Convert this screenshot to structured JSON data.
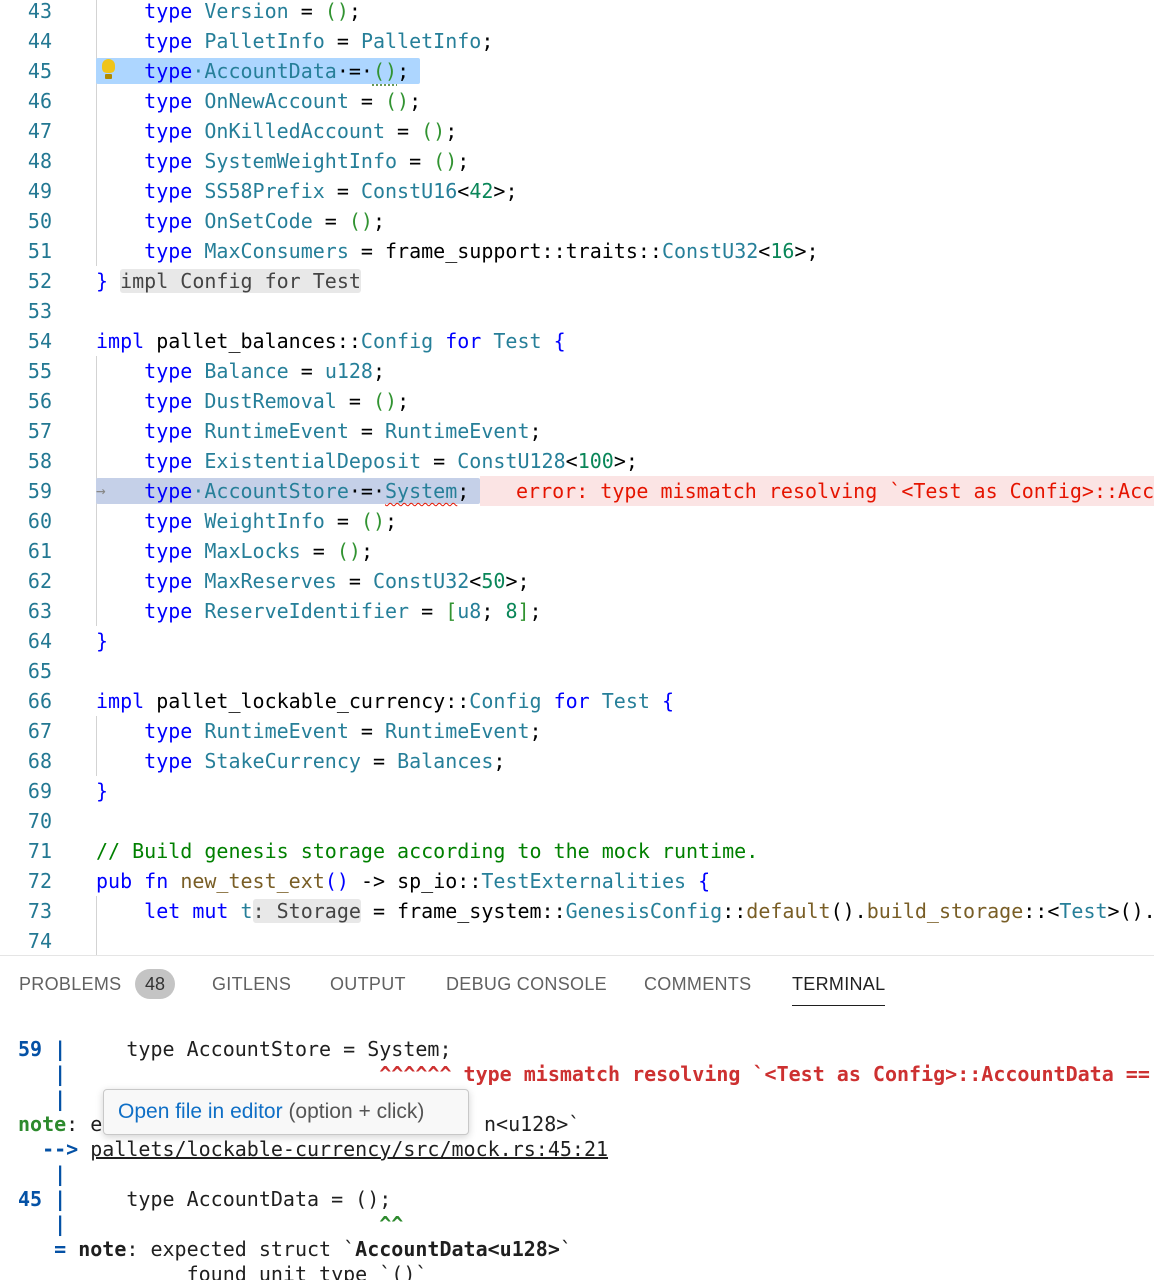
{
  "editor": {
    "lines": [
      {
        "n": "43",
        "segs": [
          [
            "    ",
            ""
          ],
          [
            "type",
            "kw"
          ],
          [
            " ",
            ""
          ],
          [
            "Version",
            "ty"
          ],
          [
            " = ",
            ""
          ],
          [
            "()",
            "pu"
          ],
          [
            ";",
            ""
          ]
        ]
      },
      {
        "n": "44",
        "segs": [
          [
            "    ",
            ""
          ],
          [
            "type",
            "kw"
          ],
          [
            " ",
            ""
          ],
          [
            "PalletInfo",
            "ty"
          ],
          [
            " = ",
            ""
          ],
          [
            "PalletInfo",
            "ty"
          ],
          [
            ";",
            ""
          ]
        ]
      },
      {
        "n": "45",
        "segs": [
          [
            "    ",
            ""
          ],
          [
            "type",
            "kw"
          ],
          [
            "·",
            "ty"
          ],
          [
            "AccountData",
            "ty"
          ],
          [
            "·=·",
            ""
          ],
          [
            "()",
            "pu dots"
          ],
          [
            ";",
            ""
          ]
        ]
      },
      {
        "n": "46",
        "segs": [
          [
            "    ",
            ""
          ],
          [
            "type",
            "kw"
          ],
          [
            " ",
            ""
          ],
          [
            "OnNewAccount",
            "ty"
          ],
          [
            " = ",
            ""
          ],
          [
            "()",
            "pu"
          ],
          [
            ";",
            ""
          ]
        ]
      },
      {
        "n": "47",
        "segs": [
          [
            "    ",
            ""
          ],
          [
            "type",
            "kw"
          ],
          [
            " ",
            ""
          ],
          [
            "OnKilledAccount",
            "ty"
          ],
          [
            " = ",
            ""
          ],
          [
            "()",
            "pu"
          ],
          [
            ";",
            ""
          ]
        ]
      },
      {
        "n": "48",
        "segs": [
          [
            "    ",
            ""
          ],
          [
            "type",
            "kw"
          ],
          [
            " ",
            ""
          ],
          [
            "SystemWeightInfo",
            "ty"
          ],
          [
            " = ",
            ""
          ],
          [
            "()",
            "pu"
          ],
          [
            ";",
            ""
          ]
        ]
      },
      {
        "n": "49",
        "segs": [
          [
            "    ",
            ""
          ],
          [
            "type",
            "kw"
          ],
          [
            " ",
            ""
          ],
          [
            "SS58Prefix",
            "ty"
          ],
          [
            " = ",
            ""
          ],
          [
            "ConstU16",
            "ty"
          ],
          [
            "<",
            ""
          ],
          [
            "42",
            "nu"
          ],
          [
            ">;",
            ""
          ]
        ]
      },
      {
        "n": "50",
        "segs": [
          [
            "    ",
            ""
          ],
          [
            "type",
            "kw"
          ],
          [
            " ",
            ""
          ],
          [
            "OnSetCode",
            "ty"
          ],
          [
            " = ",
            ""
          ],
          [
            "()",
            "pu"
          ],
          [
            ";",
            ""
          ]
        ]
      },
      {
        "n": "51",
        "segs": [
          [
            "    ",
            ""
          ],
          [
            "type",
            "kw"
          ],
          [
            " ",
            ""
          ],
          [
            "MaxConsumers",
            "ty"
          ],
          [
            " = frame_support::traits::",
            ""
          ],
          [
            "ConstU32",
            "ty"
          ],
          [
            "<",
            ""
          ],
          [
            "16",
            "nu"
          ],
          [
            ">;",
            ""
          ]
        ]
      },
      {
        "n": "52",
        "segs": [
          [
            "}",
            "kw"
          ],
          [
            " ",
            ""
          ],
          [
            "impl Config for Test",
            "hint"
          ]
        ]
      },
      {
        "n": "53",
        "segs": []
      },
      {
        "n": "54",
        "segs": [
          [
            "impl",
            "kw"
          ],
          [
            " pallet_balances::",
            ""
          ],
          [
            "Config",
            "ty"
          ],
          [
            " ",
            ""
          ],
          [
            "for",
            "kw"
          ],
          [
            " ",
            ""
          ],
          [
            "Test",
            "ty"
          ],
          [
            " ",
            ""
          ],
          [
            "{",
            "kw"
          ]
        ]
      },
      {
        "n": "55",
        "segs": [
          [
            "    ",
            ""
          ],
          [
            "type",
            "kw"
          ],
          [
            " ",
            ""
          ],
          [
            "Balance",
            "ty"
          ],
          [
            " = ",
            ""
          ],
          [
            "u128",
            "ty"
          ],
          [
            ";",
            ""
          ]
        ]
      },
      {
        "n": "56",
        "segs": [
          [
            "    ",
            ""
          ],
          [
            "type",
            "kw"
          ],
          [
            " ",
            ""
          ],
          [
            "DustRemoval",
            "ty"
          ],
          [
            " = ",
            ""
          ],
          [
            "()",
            "pu"
          ],
          [
            ";",
            ""
          ]
        ]
      },
      {
        "n": "57",
        "segs": [
          [
            "    ",
            ""
          ],
          [
            "type",
            "kw"
          ],
          [
            " ",
            ""
          ],
          [
            "RuntimeEvent",
            "ty"
          ],
          [
            " = ",
            ""
          ],
          [
            "RuntimeEvent",
            "ty"
          ],
          [
            ";",
            ""
          ]
        ]
      },
      {
        "n": "58",
        "segs": [
          [
            "    ",
            ""
          ],
          [
            "type",
            "kw"
          ],
          [
            " ",
            ""
          ],
          [
            "ExistentialDeposit",
            "ty"
          ],
          [
            " = ",
            ""
          ],
          [
            "ConstU128",
            "ty"
          ],
          [
            "<",
            ""
          ],
          [
            "100",
            "nu"
          ],
          [
            ">;",
            ""
          ]
        ]
      },
      {
        "n": "59",
        "segs": [
          [
            "    ",
            ""
          ],
          [
            "type",
            "kw"
          ],
          [
            "·",
            "ty"
          ],
          [
            "AccountStore",
            "ty"
          ],
          [
            "·=·",
            ""
          ],
          [
            "System",
            "ty squiggle"
          ],
          [
            ";",
            ""
          ]
        ]
      },
      {
        "n": "60",
        "segs": [
          [
            "    ",
            ""
          ],
          [
            "type",
            "kw"
          ],
          [
            " ",
            ""
          ],
          [
            "WeightInfo",
            "ty"
          ],
          [
            " = ",
            ""
          ],
          [
            "()",
            "pu"
          ],
          [
            ";",
            ""
          ]
        ]
      },
      {
        "n": "61",
        "segs": [
          [
            "    ",
            ""
          ],
          [
            "type",
            "kw"
          ],
          [
            " ",
            ""
          ],
          [
            "MaxLocks",
            "ty"
          ],
          [
            " = ",
            ""
          ],
          [
            "()",
            "pu"
          ],
          [
            ";",
            ""
          ]
        ]
      },
      {
        "n": "62",
        "segs": [
          [
            "    ",
            ""
          ],
          [
            "type",
            "kw"
          ],
          [
            " ",
            ""
          ],
          [
            "MaxReserves",
            "ty"
          ],
          [
            " = ",
            ""
          ],
          [
            "ConstU32",
            "ty"
          ],
          [
            "<",
            ""
          ],
          [
            "50",
            "nu"
          ],
          [
            ">;",
            ""
          ]
        ]
      },
      {
        "n": "63",
        "segs": [
          [
            "    ",
            ""
          ],
          [
            "type",
            "kw"
          ],
          [
            " ",
            ""
          ],
          [
            "ReserveIdentifier",
            "ty"
          ],
          [
            " = ",
            ""
          ],
          [
            "[",
            "pu"
          ],
          [
            "u8",
            "ty"
          ],
          [
            "; ",
            ""
          ],
          [
            "8",
            "nu"
          ],
          [
            "]",
            "pu"
          ],
          [
            ";",
            ""
          ]
        ]
      },
      {
        "n": "64",
        "segs": [
          [
            "}",
            "kw"
          ]
        ]
      },
      {
        "n": "65",
        "segs": []
      },
      {
        "n": "66",
        "segs": [
          [
            "impl",
            "kw"
          ],
          [
            " pallet_lockable_currency::",
            ""
          ],
          [
            "Config",
            "ty"
          ],
          [
            " ",
            ""
          ],
          [
            "for",
            "kw"
          ],
          [
            " ",
            ""
          ],
          [
            "Test",
            "ty"
          ],
          [
            " ",
            ""
          ],
          [
            "{",
            "kw"
          ]
        ]
      },
      {
        "n": "67",
        "segs": [
          [
            "    ",
            ""
          ],
          [
            "type",
            "kw"
          ],
          [
            " ",
            ""
          ],
          [
            "RuntimeEvent",
            "ty"
          ],
          [
            " = ",
            ""
          ],
          [
            "RuntimeEvent",
            "ty"
          ],
          [
            ";",
            ""
          ]
        ]
      },
      {
        "n": "68",
        "segs": [
          [
            "    ",
            ""
          ],
          [
            "type",
            "kw"
          ],
          [
            " ",
            ""
          ],
          [
            "StakeCurrency",
            "ty"
          ],
          [
            " = ",
            ""
          ],
          [
            "Balances",
            "ty"
          ],
          [
            ";",
            ""
          ]
        ]
      },
      {
        "n": "69",
        "segs": [
          [
            "}",
            "kw"
          ]
        ]
      },
      {
        "n": "70",
        "segs": []
      },
      {
        "n": "71",
        "segs": [
          [
            "// Build genesis storage according to the mock runtime.",
            "cm"
          ]
        ]
      },
      {
        "n": "72",
        "segs": [
          [
            "pub",
            "kw"
          ],
          [
            " ",
            ""
          ],
          [
            "fn",
            "kw"
          ],
          [
            " ",
            ""
          ],
          [
            "new_test_ext",
            "fn"
          ],
          [
            "()",
            "kw"
          ],
          [
            " -> sp_io::",
            ""
          ],
          [
            "TestExternalities",
            "ty"
          ],
          [
            " ",
            ""
          ],
          [
            "{",
            "kw"
          ]
        ]
      },
      {
        "n": "73",
        "segs": [
          [
            "    ",
            ""
          ],
          [
            "let",
            "kw"
          ],
          [
            " ",
            ""
          ],
          [
            "mut",
            "kw"
          ],
          [
            " ",
            ""
          ],
          [
            "t",
            "ty"
          ],
          [
            ": Storage",
            "hint"
          ],
          [
            " = frame_system::",
            ""
          ],
          [
            "GenesisConfig",
            "ty"
          ],
          [
            "::",
            ""
          ],
          [
            "default",
            "fn"
          ],
          [
            "().",
            ""
          ],
          [
            "build_storage",
            "fn"
          ],
          [
            "::<",
            ""
          ],
          [
            "Test",
            "ty"
          ],
          [
            ">().",
            ""
          ]
        ]
      },
      {
        "n": "74",
        "segs": []
      }
    ],
    "inline_error": "error: type mismatch resolving `<Test as Config>::Acc"
  },
  "panel": {
    "tabs": [
      "PROBLEMS",
      "GITLENS",
      "OUTPUT",
      "DEBUG CONSOLE",
      "COMMENTS",
      "TERMINAL"
    ],
    "problems_count": "48",
    "active_tab": "TERMINAL"
  },
  "terminal": {
    "l1_num": "59",
    "l1_bar": " |",
    "l1_code": "     type AccountStore = System;",
    "l2_bar": "   |",
    "l2_carets": "                          ^^^^^^",
    "l2_msg": " type mismatch resolving `<Test as Config>::AccountData ==",
    "l3_bar": "   |",
    "l4_note": "note",
    "l4_rest": ": e",
    "l4_tail": "n<u128>`",
    "l5_arrow": "  -->",
    "l5_path": "pallets/lockable-currency/src/mock.rs:45:21",
    "l6_bar": "   |",
    "l7_num": "45",
    "l7_bar": " |",
    "l7_code": "     type AccountData = ();",
    "l8_bar": "   |",
    "l8_carets": "                          ^^",
    "l9_eq": "   =",
    "l9_note": " note",
    "l9_rest": ": expected struct `",
    "l9_bold": "AccountData<u128>",
    "l9_end": "`",
    "l10": "              found unit type `()`"
  },
  "tooltip": {
    "link": "Open file in editor",
    "hint": " (option + click)"
  }
}
